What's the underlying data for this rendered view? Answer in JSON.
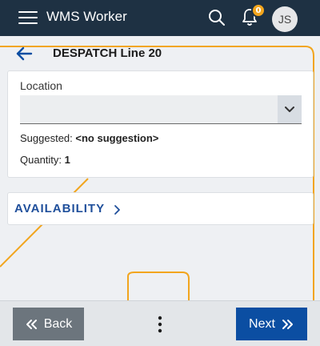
{
  "appbar": {
    "title": "WMS Worker",
    "notification_count": "0",
    "user_initials": "JS",
    "menu_icon": "hamburger-icon",
    "search_icon": "search-icon",
    "bell_icon": "bell-icon"
  },
  "page": {
    "title": "DESPATCH Line 20",
    "back_icon": "arrow-left-icon"
  },
  "location_card": {
    "label": "Location",
    "input_value": "",
    "dropdown_icon": "chevron-down-icon",
    "suggested_label": "Suggested: ",
    "suggested_value": "<no suggestion>",
    "quantity_label": "Quantity: ",
    "quantity_value": "1"
  },
  "availability": {
    "label": "AVAILABILITY",
    "chevron_icon": "chevron-right-icon"
  },
  "bottombar": {
    "back_label": "Back",
    "next_label": "Next",
    "more_icon": "more-vertical-icon"
  },
  "colors": {
    "appbar": "#1e3143",
    "badge": "#f2a51d",
    "accent_lines": "#f2a51d",
    "next_button": "#0b4ea2",
    "back_button": "#6c757d",
    "availability_text": "#1f4f9b"
  }
}
